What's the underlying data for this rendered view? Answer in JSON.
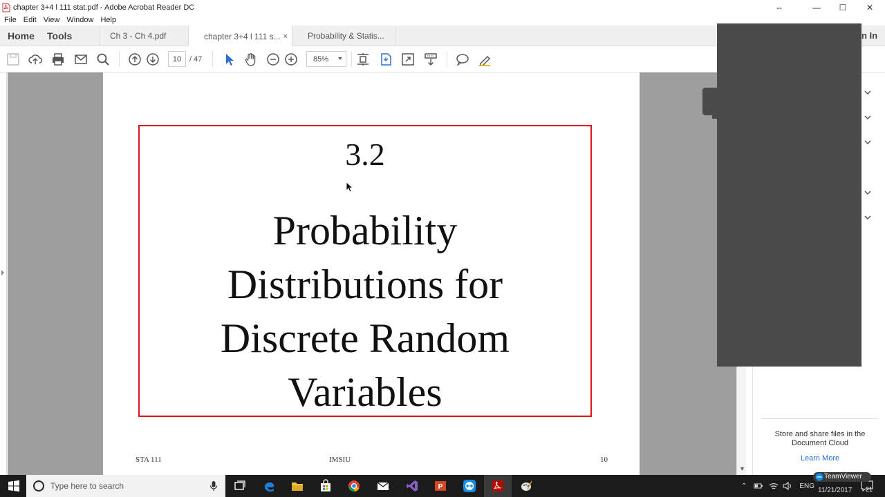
{
  "window": {
    "title": "chapter 3+4 l 111 stat.pdf - Adobe Acrobat Reader DC",
    "controls": {
      "restore": "⇔",
      "minimize": "—",
      "maximize": "☐",
      "close": "✕"
    }
  },
  "menu": [
    "File",
    "Edit",
    "View",
    "Window",
    "Help"
  ],
  "tabs": {
    "home": "Home",
    "tools": "Tools",
    "documents": [
      {
        "label": "Ch 3 - Ch 4.pdf",
        "active": false
      },
      {
        "label": "chapter 3+4 l 111 s...",
        "active": true,
        "close": "×"
      },
      {
        "label": "Probability & Statis...",
        "active": false
      }
    ],
    "sign_in": "n In"
  },
  "toolbar": {
    "page_current": "10",
    "page_total": "/ 47",
    "zoom": "85%",
    "icons": [
      "save-icon",
      "upload-icon",
      "print-icon",
      "email-icon",
      "search-icon",
      "prev-page-icon",
      "next-page-icon",
      "select-cursor-icon",
      "hand-icon",
      "zoom-out-icon",
      "zoom-in-icon",
      "fit-page-icon",
      "scroll-mode-icon",
      "fullscreen-icon",
      "read-mode-icon",
      "comment-icon",
      "highlight-icon"
    ]
  },
  "document": {
    "slide_number": "3.2",
    "slide_title_lines": [
      "Probability",
      "Distributions for",
      "Discrete Random",
      "Variables"
    ],
    "footer_left": "STA 111",
    "footer_center": "IMSIU",
    "footer_right": "10"
  },
  "right_panel": {
    "cloud_text": "Store and share files in the Document Cloud",
    "learn_more": "Learn More"
  },
  "taskbar": {
    "search_placeholder": "Type here to search",
    "apps": [
      "task-view-icon",
      "edge-icon",
      "file-explorer-icon",
      "store-icon",
      "chrome-icon",
      "mail-icon",
      "visual-studio-icon",
      "powerpoint-icon",
      "teamviewer-icon",
      "acrobat-icon",
      "paint-icon"
    ],
    "tray_lang": "ENG",
    "date": "11/21/2017",
    "notification_count": "21",
    "teamviewer_badge": "TeamViewer"
  },
  "colors": {
    "slide_border": "#e0141b",
    "doc_bg": "#9e9e9e",
    "overlay": "#4a4a4a",
    "link": "#2a6ed8"
  }
}
